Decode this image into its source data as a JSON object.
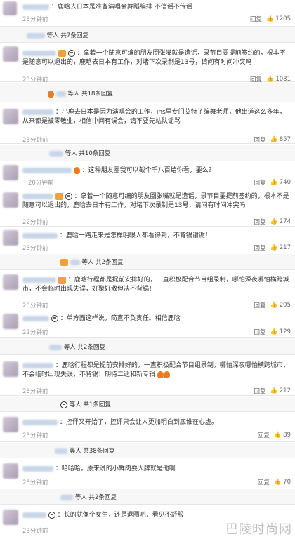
{
  "comments": [
    {
      "text": "：鹿晗去日本是准备演唱会舞蹈编排 不信谣不传谣",
      "time": "23分钟前",
      "reply": "回复",
      "likes": "1205",
      "vip": false,
      "panda": false
    },
    {
      "sub_more": "等人 共7条回复"
    },
    {
      "text": "：拿着一个随意可编的朋友圈张嘴就是造谣，录节目要提前签约的，根本不是随意可以退出的，鹿晗去日本有工作，对堵下次录制是13号，请问有时间冲突吗",
      "time": "23分钟前",
      "reply": "回复",
      "likes": "1081",
      "vip": true,
      "panda": true
    },
    {
      "sub_more": "等人 共18条回复"
    },
    {
      "text": "：小鹿去日本是因为演唱会的工作，ins里专门艾特了编舞老师，他出道这么多年，从来都是被零敬业，相信中间有误会，请不要先站队谣骂",
      "time": "23分钟前",
      "reply": "回复",
      "likes": "857",
      "vip": false,
      "panda": false
    },
    {
      "sub_more": "等人 共10条回复"
    },
    {
      "text": "：这种朋友圈我可以截个千八百给你看，要么？",
      "time": "20分钟前",
      "reply": "回复",
      "likes": "740",
      "vip": false,
      "panda": false
    },
    {
      "text": "：拿着一个随意可编的朋友圈张嘴就是造谣，录节目要提前签约的，根本不是随意可以退出的，鹿晗去日本有工作，对堵下次录制是13号，请问有时间冲突吗",
      "time": "22分钟前",
      "reply": "回复",
      "likes": "274",
      "vip": true,
      "panda": true
    },
    {
      "text": "：鹿晗一路走来是怎样明眼人都看得到，不背锅谢谢！",
      "time": "23分钟前",
      "reply": "回复",
      "likes": "217",
      "vip": false,
      "panda": false
    },
    {
      "sub_more": "等人 共2条回复"
    },
    {
      "text": "：鹿晗行程都是提前安排好的，一直积极配合节目组录制，哪怕深夜哪怕横跨城市，不会临时出现失误，好聚好散但决不背锅！",
      "time": "23分钟前",
      "reply": "回复",
      "likes": "205",
      "vip": false,
      "panda": false
    },
    {
      "text": "：单方面这样说，简直不负责任。相信鹿晗",
      "time": "22分钟前",
      "reply": "回复",
      "likes": "129",
      "vip": false,
      "panda": true
    },
    {
      "sub_more": "等人 共2条回复"
    },
    {
      "text": "：鹿晗行程都是提前安排好的，一直积极配合节目组录制，哪怕深夜哪怕横跨城市，不会临时出现失误，不背锅！期待二巡和新专辑",
      "time": "23分钟前",
      "reply": "回复",
      "likes": "212",
      "vip": false,
      "panda": false
    },
    {
      "sub_more": "等人 共1条回复"
    },
    {
      "text": "：控评又开始了，控评只会让人更加明白到底谁在心虚。",
      "time": "23分钟前",
      "reply": "回复",
      "likes": "89",
      "vip": false,
      "panda": false
    },
    {
      "sub_more": "等人 共38条回复"
    },
    {
      "text": "：哈哈哈，原来说的小鲜肉耍大牌就是他啊",
      "time": "23分钟前",
      "reply": "回复",
      "likes": "70",
      "vip": false,
      "panda": false
    },
    {
      "sub_more": "等人 共2条回复"
    },
    {
      "text": "：长的就像个女生，还是退圈吧，看见不舒服",
      "time": "23分钟前",
      "reply": "回复",
      "likes": "",
      "vip": false,
      "panda": true
    }
  ],
  "watermark": "巴陵时尚网"
}
